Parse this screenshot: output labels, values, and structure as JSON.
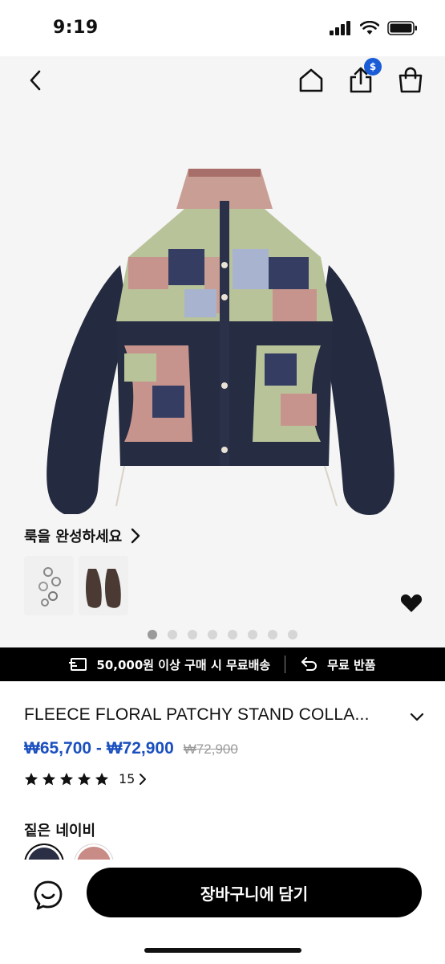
{
  "status_bar": {
    "time": "9:19"
  },
  "nav": {
    "share_badge": "$",
    "icons": [
      "back-icon",
      "home-icon",
      "share-icon",
      "shopping-bag-icon"
    ]
  },
  "hero": {
    "look_title": "룩을 완성하세요",
    "carousel": {
      "count": 8,
      "active": 1
    }
  },
  "promo": {
    "shipping": "50,000원 이상 구매 시 무료배송",
    "returns": "무료 반품"
  },
  "product": {
    "title": "FLEECE FLORAL PATCHY STAND COLLA...",
    "price_range": "₩65,700 - ₩72,900",
    "original_price": "₩72,900",
    "rating_stars": 5,
    "review_count": "15"
  },
  "color": {
    "label": "짙은 네이비",
    "swatches": [
      "#2a2f45",
      "#c98b86"
    ]
  },
  "bottom": {
    "cart_label": "장바구니에 담기"
  },
  "colors": {
    "accent_price": "#1a4fbf",
    "badge": "#1a5bd6",
    "promo_bg": "#000000"
  }
}
